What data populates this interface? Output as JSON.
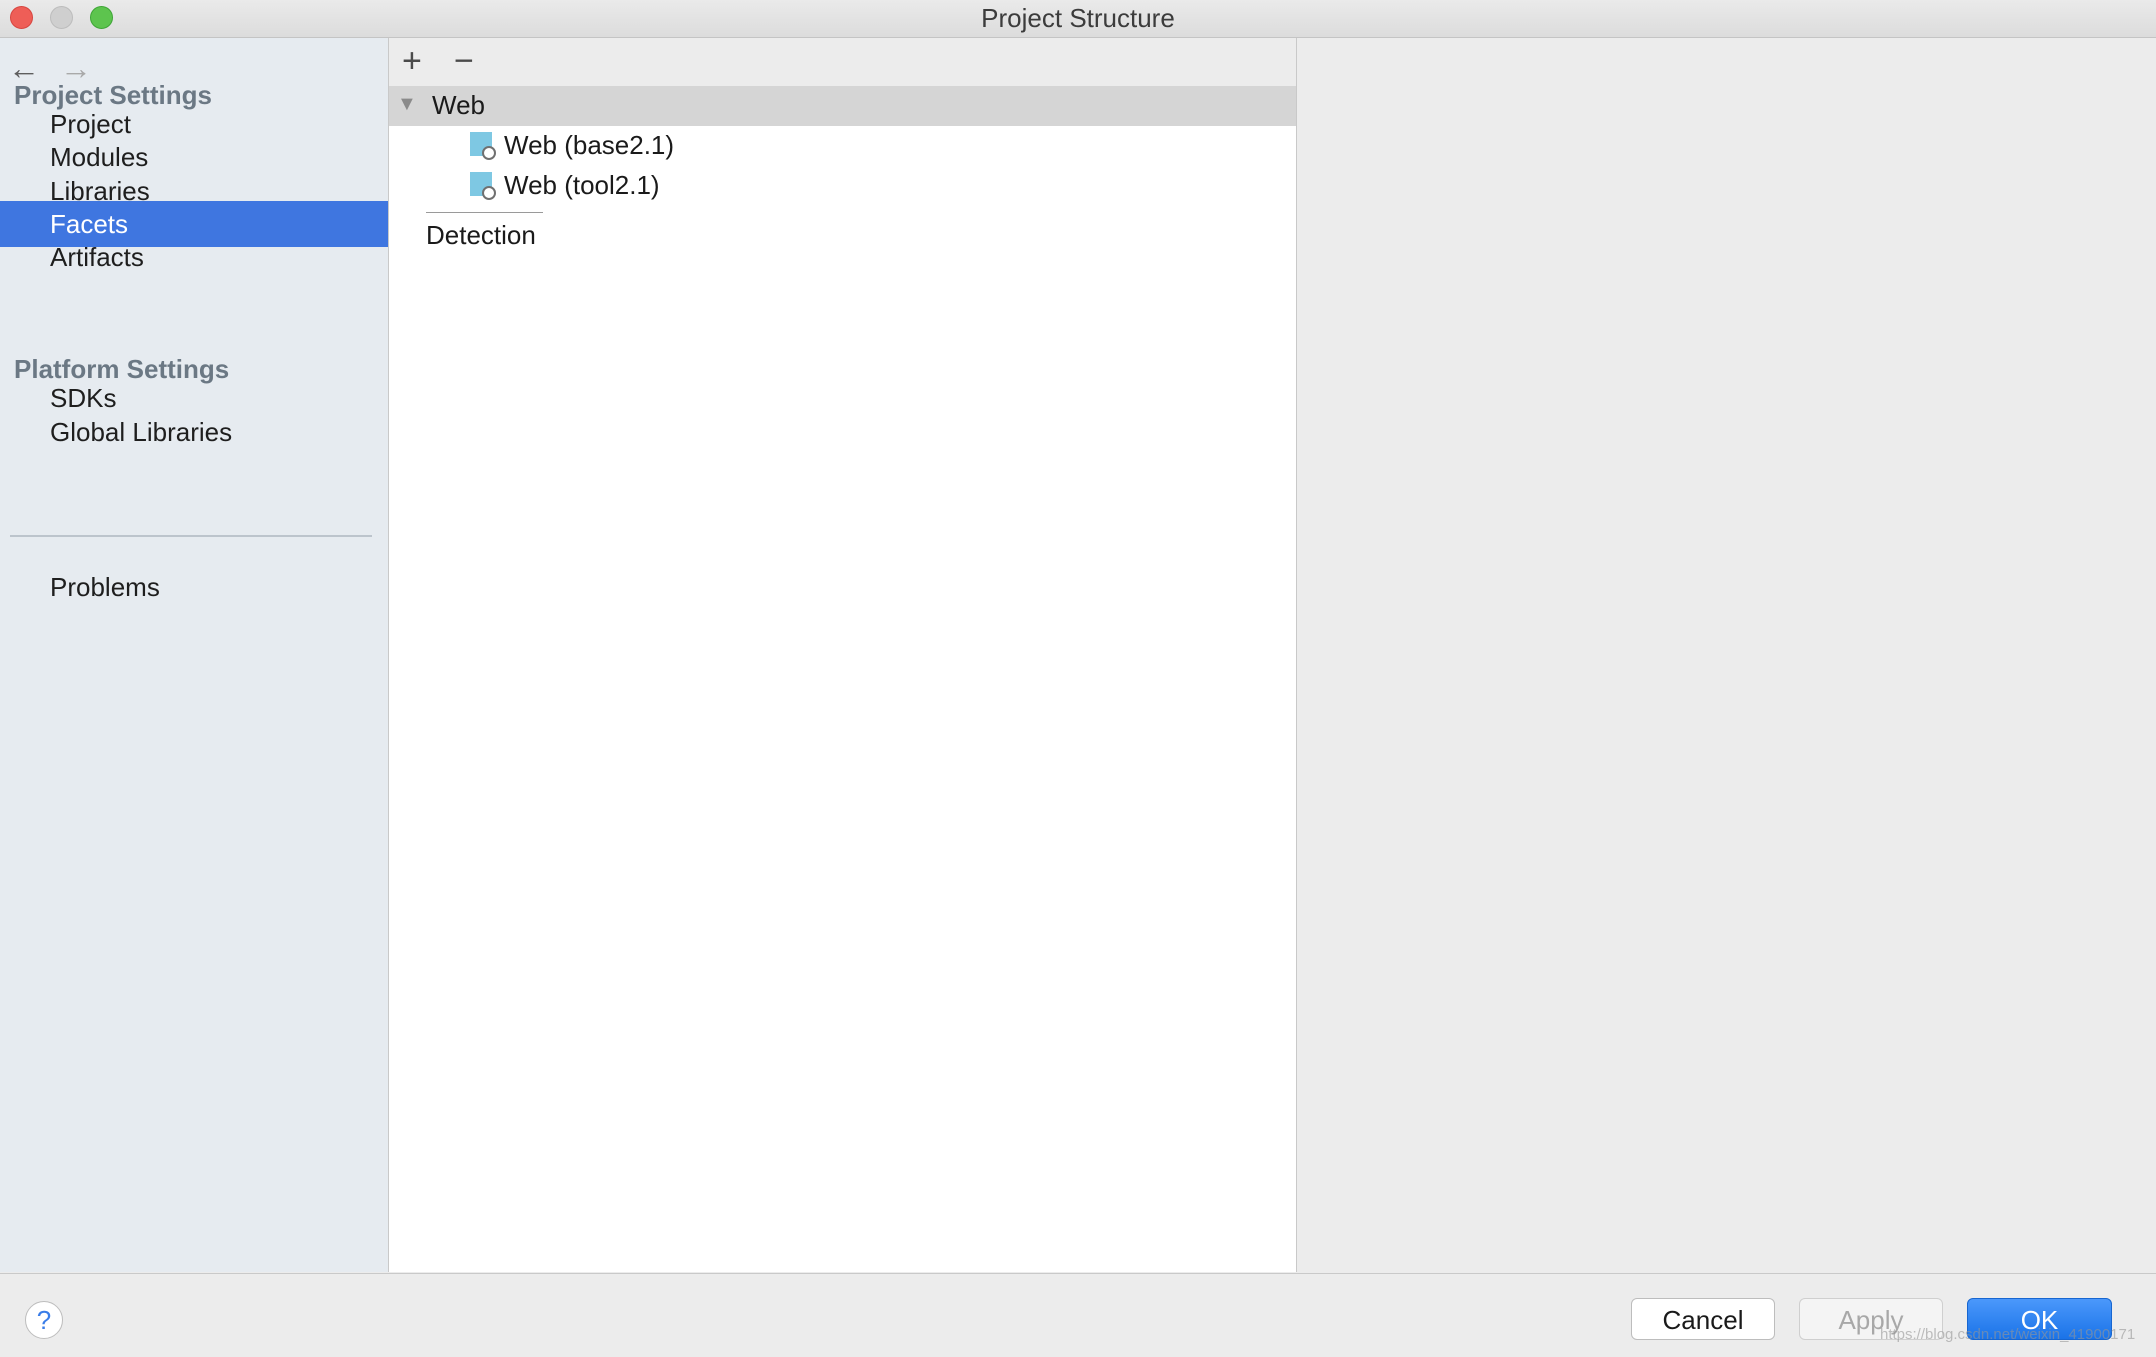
{
  "window": {
    "title": "Project Structure"
  },
  "sidebar": {
    "nav": {
      "back_icon": "arrow-left-icon",
      "forward_icon": "arrow-right-icon"
    },
    "project_settings": {
      "header": "Project Settings",
      "items": [
        {
          "label": "Project"
        },
        {
          "label": "Modules"
        },
        {
          "label": "Libraries"
        },
        {
          "label": "Facets",
          "selected": true
        },
        {
          "label": "Artifacts"
        }
      ]
    },
    "platform_settings": {
      "header": "Platform Settings",
      "items": [
        {
          "label": "SDKs"
        },
        {
          "label": "Global Libraries"
        }
      ]
    },
    "problems": {
      "label": "Problems"
    }
  },
  "toolbar": {
    "add_icon": "plus-icon",
    "remove_icon": "minus-icon",
    "add_glyph": "+",
    "remove_glyph": "−"
  },
  "tree": {
    "root": {
      "label": "Web",
      "expanded": true
    },
    "children": [
      {
        "label": "Web (base2.1)",
        "icon": "web-facet-icon"
      },
      {
        "label": "Web (tool2.1)",
        "icon": "web-facet-icon"
      }
    ],
    "detection_label": "Detection"
  },
  "footer": {
    "help_glyph": "?",
    "cancel_label": "Cancel",
    "apply_label": "Apply",
    "ok_label": "OK",
    "watermark": "https://blog.csdn.net/weixin_41900171"
  },
  "colors": {
    "selection": "#3f76e0",
    "sidebar_bg": "#e6ebf0",
    "section_header": "#6b7884",
    "ok_button": "#1a73e8"
  }
}
